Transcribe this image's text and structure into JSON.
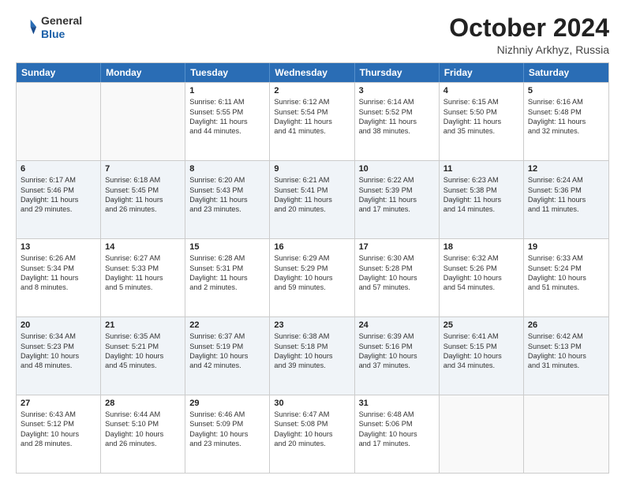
{
  "header": {
    "logo_general": "General",
    "logo_blue": "Blue",
    "month": "October 2024",
    "location": "Nizhniy Arkhyz, Russia"
  },
  "weekdays": [
    "Sunday",
    "Monday",
    "Tuesday",
    "Wednesday",
    "Thursday",
    "Friday",
    "Saturday"
  ],
  "rows": [
    [
      {
        "day": "",
        "lines": [],
        "empty": true
      },
      {
        "day": "",
        "lines": [],
        "empty": true
      },
      {
        "day": "1",
        "lines": [
          "Sunrise: 6:11 AM",
          "Sunset: 5:55 PM",
          "Daylight: 11 hours",
          "and 44 minutes."
        ]
      },
      {
        "day": "2",
        "lines": [
          "Sunrise: 6:12 AM",
          "Sunset: 5:54 PM",
          "Daylight: 11 hours",
          "and 41 minutes."
        ]
      },
      {
        "day": "3",
        "lines": [
          "Sunrise: 6:14 AM",
          "Sunset: 5:52 PM",
          "Daylight: 11 hours",
          "and 38 minutes."
        ]
      },
      {
        "day": "4",
        "lines": [
          "Sunrise: 6:15 AM",
          "Sunset: 5:50 PM",
          "Daylight: 11 hours",
          "and 35 minutes."
        ]
      },
      {
        "day": "5",
        "lines": [
          "Sunrise: 6:16 AM",
          "Sunset: 5:48 PM",
          "Daylight: 11 hours",
          "and 32 minutes."
        ]
      }
    ],
    [
      {
        "day": "6",
        "lines": [
          "Sunrise: 6:17 AM",
          "Sunset: 5:46 PM",
          "Daylight: 11 hours",
          "and 29 minutes."
        ]
      },
      {
        "day": "7",
        "lines": [
          "Sunrise: 6:18 AM",
          "Sunset: 5:45 PM",
          "Daylight: 11 hours",
          "and 26 minutes."
        ]
      },
      {
        "day": "8",
        "lines": [
          "Sunrise: 6:20 AM",
          "Sunset: 5:43 PM",
          "Daylight: 11 hours",
          "and 23 minutes."
        ]
      },
      {
        "day": "9",
        "lines": [
          "Sunrise: 6:21 AM",
          "Sunset: 5:41 PM",
          "Daylight: 11 hours",
          "and 20 minutes."
        ]
      },
      {
        "day": "10",
        "lines": [
          "Sunrise: 6:22 AM",
          "Sunset: 5:39 PM",
          "Daylight: 11 hours",
          "and 17 minutes."
        ]
      },
      {
        "day": "11",
        "lines": [
          "Sunrise: 6:23 AM",
          "Sunset: 5:38 PM",
          "Daylight: 11 hours",
          "and 14 minutes."
        ]
      },
      {
        "day": "12",
        "lines": [
          "Sunrise: 6:24 AM",
          "Sunset: 5:36 PM",
          "Daylight: 11 hours",
          "and 11 minutes."
        ]
      }
    ],
    [
      {
        "day": "13",
        "lines": [
          "Sunrise: 6:26 AM",
          "Sunset: 5:34 PM",
          "Daylight: 11 hours",
          "and 8 minutes."
        ]
      },
      {
        "day": "14",
        "lines": [
          "Sunrise: 6:27 AM",
          "Sunset: 5:33 PM",
          "Daylight: 11 hours",
          "and 5 minutes."
        ]
      },
      {
        "day": "15",
        "lines": [
          "Sunrise: 6:28 AM",
          "Sunset: 5:31 PM",
          "Daylight: 11 hours",
          "and 2 minutes."
        ]
      },
      {
        "day": "16",
        "lines": [
          "Sunrise: 6:29 AM",
          "Sunset: 5:29 PM",
          "Daylight: 10 hours",
          "and 59 minutes."
        ]
      },
      {
        "day": "17",
        "lines": [
          "Sunrise: 6:30 AM",
          "Sunset: 5:28 PM",
          "Daylight: 10 hours",
          "and 57 minutes."
        ]
      },
      {
        "day": "18",
        "lines": [
          "Sunrise: 6:32 AM",
          "Sunset: 5:26 PM",
          "Daylight: 10 hours",
          "and 54 minutes."
        ]
      },
      {
        "day": "19",
        "lines": [
          "Sunrise: 6:33 AM",
          "Sunset: 5:24 PM",
          "Daylight: 10 hours",
          "and 51 minutes."
        ]
      }
    ],
    [
      {
        "day": "20",
        "lines": [
          "Sunrise: 6:34 AM",
          "Sunset: 5:23 PM",
          "Daylight: 10 hours",
          "and 48 minutes."
        ]
      },
      {
        "day": "21",
        "lines": [
          "Sunrise: 6:35 AM",
          "Sunset: 5:21 PM",
          "Daylight: 10 hours",
          "and 45 minutes."
        ]
      },
      {
        "day": "22",
        "lines": [
          "Sunrise: 6:37 AM",
          "Sunset: 5:19 PM",
          "Daylight: 10 hours",
          "and 42 minutes."
        ]
      },
      {
        "day": "23",
        "lines": [
          "Sunrise: 6:38 AM",
          "Sunset: 5:18 PM",
          "Daylight: 10 hours",
          "and 39 minutes."
        ]
      },
      {
        "day": "24",
        "lines": [
          "Sunrise: 6:39 AM",
          "Sunset: 5:16 PM",
          "Daylight: 10 hours",
          "and 37 minutes."
        ]
      },
      {
        "day": "25",
        "lines": [
          "Sunrise: 6:41 AM",
          "Sunset: 5:15 PM",
          "Daylight: 10 hours",
          "and 34 minutes."
        ]
      },
      {
        "day": "26",
        "lines": [
          "Sunrise: 6:42 AM",
          "Sunset: 5:13 PM",
          "Daylight: 10 hours",
          "and 31 minutes."
        ]
      }
    ],
    [
      {
        "day": "27",
        "lines": [
          "Sunrise: 6:43 AM",
          "Sunset: 5:12 PM",
          "Daylight: 10 hours",
          "and 28 minutes."
        ]
      },
      {
        "day": "28",
        "lines": [
          "Sunrise: 6:44 AM",
          "Sunset: 5:10 PM",
          "Daylight: 10 hours",
          "and 26 minutes."
        ]
      },
      {
        "day": "29",
        "lines": [
          "Sunrise: 6:46 AM",
          "Sunset: 5:09 PM",
          "Daylight: 10 hours",
          "and 23 minutes."
        ]
      },
      {
        "day": "30",
        "lines": [
          "Sunrise: 6:47 AM",
          "Sunset: 5:08 PM",
          "Daylight: 10 hours",
          "and 20 minutes."
        ]
      },
      {
        "day": "31",
        "lines": [
          "Sunrise: 6:48 AM",
          "Sunset: 5:06 PM",
          "Daylight: 10 hours",
          "and 17 minutes."
        ]
      },
      {
        "day": "",
        "lines": [],
        "empty": true
      },
      {
        "day": "",
        "lines": [],
        "empty": true
      }
    ]
  ]
}
